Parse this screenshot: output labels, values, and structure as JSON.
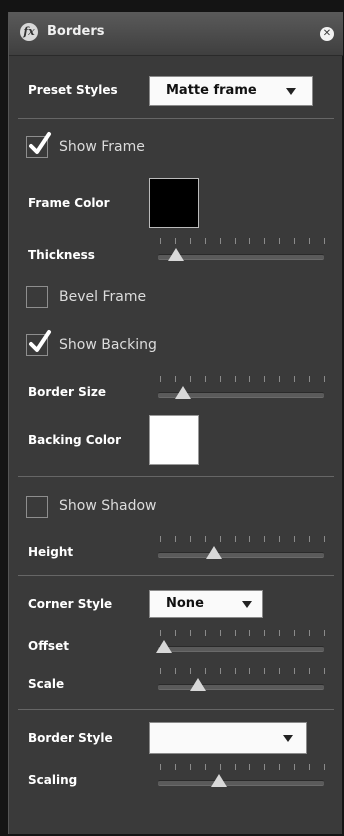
{
  "panel": {
    "title": "Borders",
    "fx_icon": "fx",
    "close_icon": "✕"
  },
  "preset": {
    "label": "Preset Styles",
    "value": "Matte frame"
  },
  "show_frame": {
    "label": "Show Frame",
    "checked": true
  },
  "frame_color": {
    "label": "Frame Color",
    "color": "#000000"
  },
  "thickness": {
    "label": "Thickness",
    "value_fraction": 0.08
  },
  "bevel_frame": {
    "label": "Bevel Frame",
    "checked": false
  },
  "show_backing": {
    "label": "Show Backing",
    "checked": true
  },
  "border_size": {
    "label": "Border Size",
    "value_fraction": 0.12
  },
  "backing_color": {
    "label": "Backing Color",
    "color": "#ffffff"
  },
  "show_shadow": {
    "label": "Show Shadow",
    "checked": false
  },
  "height": {
    "label": "Height",
    "value_fraction": 0.32
  },
  "corner_style": {
    "label": "Corner Style",
    "value": "None"
  },
  "offset": {
    "label": "Offset",
    "value_fraction": 0.0
  },
  "scale": {
    "label": "Scale",
    "value_fraction": 0.22
  },
  "border_style": {
    "label": "Border Style",
    "value": ""
  },
  "scaling": {
    "label": "Scaling",
    "value_fraction": 0.35
  },
  "colors": {
    "panel_bg": "#3a3a3a",
    "titlebar_bg": "#4a4a4a",
    "checkmark": "#ffffff"
  }
}
